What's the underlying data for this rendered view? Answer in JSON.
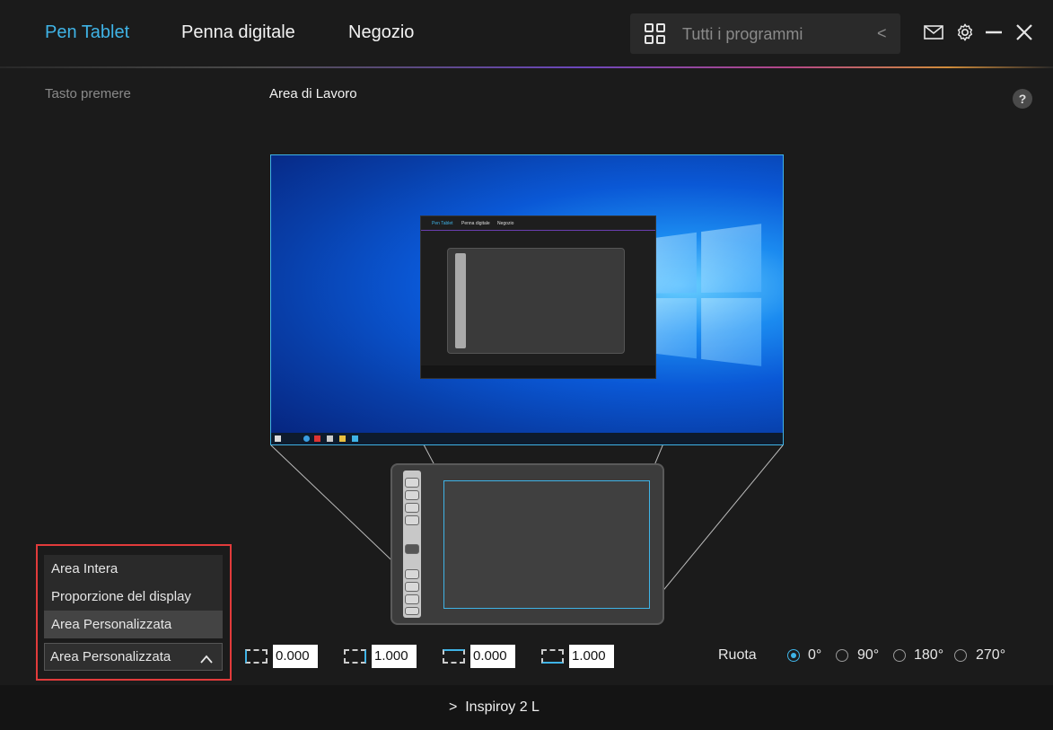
{
  "header": {
    "tabs": [
      {
        "label": "Pen Tablet",
        "active": true
      },
      {
        "label": "Penna digitale",
        "active": false
      },
      {
        "label": "Negozio",
        "active": false
      }
    ],
    "search": {
      "placeholder": "Tutti i programmi",
      "icon": "grid-icon",
      "chevron": "<"
    },
    "icons": [
      "mail-icon",
      "gear-icon",
      "minimize-icon",
      "close-icon"
    ],
    "accent_color": "#3fb3e6"
  },
  "subtabs": [
    {
      "label": "Tasto premere",
      "active": false
    },
    {
      "label": "Area di Lavoro",
      "active": true
    }
  ],
  "help_label": "?",
  "mini_app": {
    "tabs": [
      "Pen Tablet",
      "Penna digitale",
      "Negozio"
    ]
  },
  "dropdown": {
    "options": [
      {
        "label": "Area Intera",
        "selected": false
      },
      {
        "label": "Proporzione del display",
        "selected": false
      },
      {
        "label": "Area Personalizzata",
        "selected": true
      }
    ],
    "selected_value": "Area Personalizzata",
    "highlight_color": "#e23b3b"
  },
  "coordinates": [
    {
      "value": "0.000",
      "edge": "left"
    },
    {
      "value": "1.000",
      "edge": "right"
    },
    {
      "value": "0.000",
      "edge": "top"
    },
    {
      "value": "1.000",
      "edge": "bottom"
    }
  ],
  "rotation": {
    "label": "Ruota",
    "options": [
      {
        "label": "0°",
        "selected": true
      },
      {
        "label": "90°",
        "selected": false
      },
      {
        "label": "180°",
        "selected": false
      },
      {
        "label": "270°",
        "selected": false
      }
    ]
  },
  "footer": {
    "chevron": ">",
    "device_name": "Inspiroy 2 L"
  }
}
